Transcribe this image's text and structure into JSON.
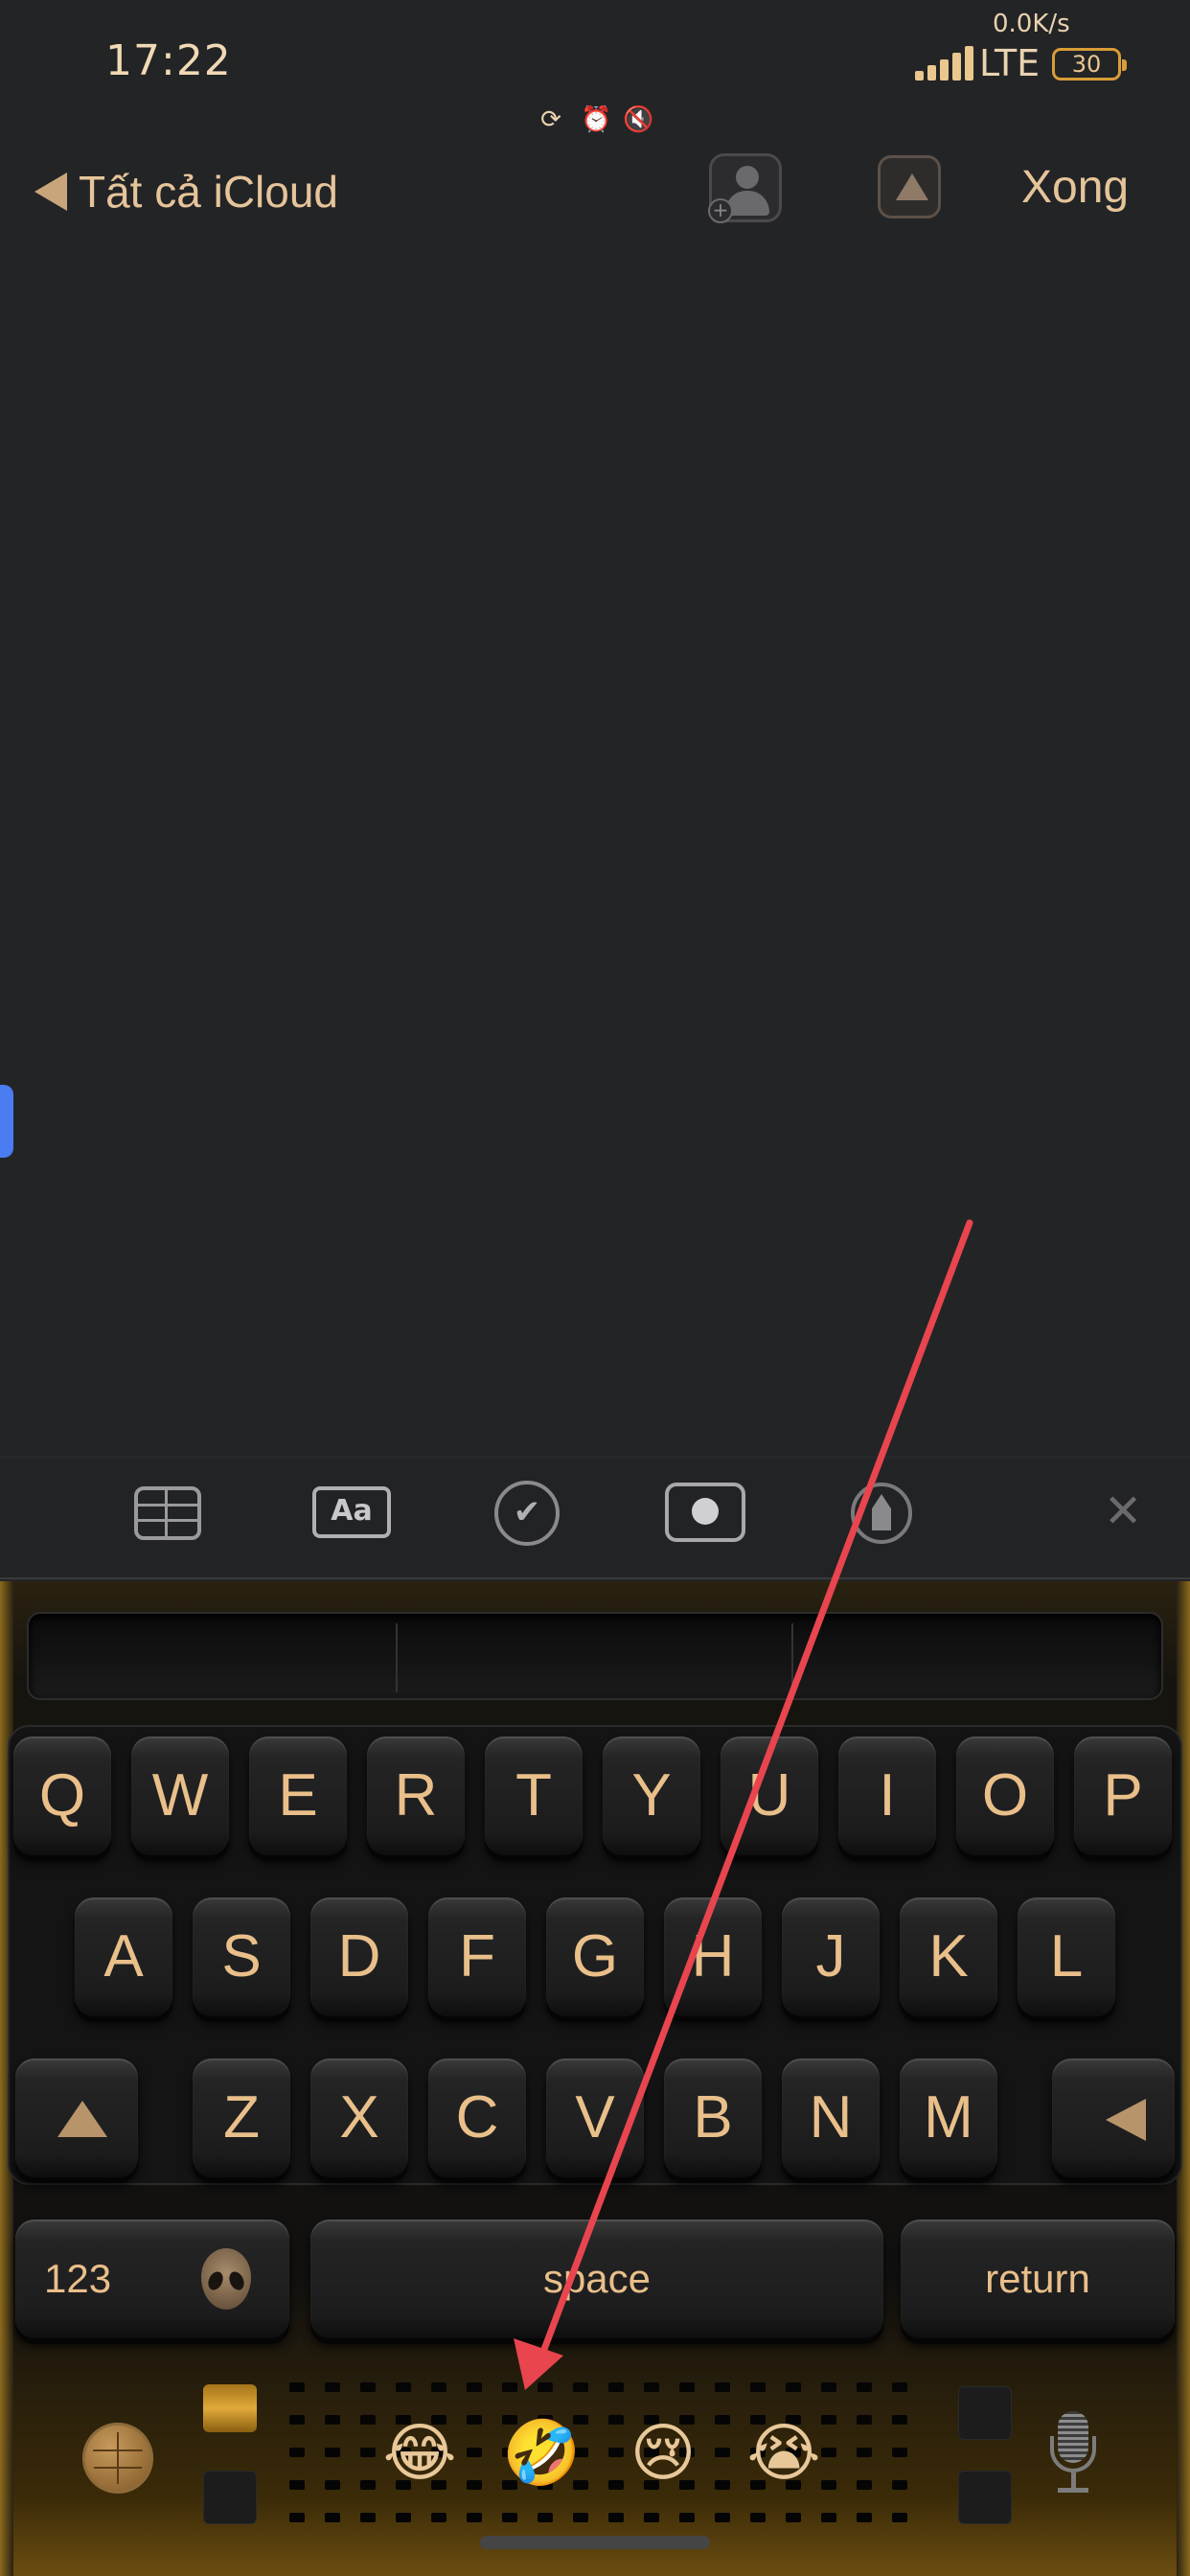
{
  "status_bar": {
    "time": "17:22",
    "net_speed": "0.0K/s",
    "network": "LTE",
    "battery": "30",
    "icons": [
      "orientation-lock-icon",
      "alarm-icon",
      "mute-icon"
    ]
  },
  "nav": {
    "back_label": "Tất cả iCloud",
    "done_label": "Xong",
    "icons": [
      "add-person-icon",
      "upload-icon"
    ]
  },
  "toolbar": {
    "format_label": "Aa",
    "check_glyph": "✔",
    "close_glyph": "✕",
    "icons": [
      "table-icon",
      "text-format-icon",
      "checklist-icon",
      "camera-icon",
      "markup-icon",
      "close-icon"
    ]
  },
  "keyboard": {
    "row1": [
      "Q",
      "W",
      "E",
      "R",
      "T",
      "Y",
      "U",
      "I",
      "O",
      "P"
    ],
    "row2": [
      "A",
      "S",
      "D",
      "F",
      "G",
      "H",
      "J",
      "K",
      "L"
    ],
    "row3": [
      "Z",
      "X",
      "C",
      "V",
      "B",
      "N",
      "M"
    ],
    "numbers_label": "123",
    "space_label": "space",
    "return_label": "return",
    "emojis": [
      "😂",
      "🤣",
      "😢",
      "😭"
    ],
    "colors": {
      "key_text": "#e9bf8a",
      "accent_gold": "#d89d37"
    }
  },
  "annotation": {
    "color": "#e8454f"
  }
}
